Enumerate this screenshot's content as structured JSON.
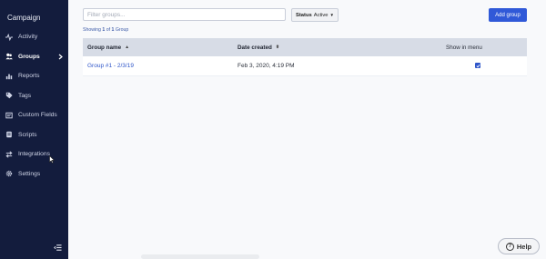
{
  "sidebar": {
    "app_title": "Campaign",
    "items": [
      {
        "label": "Activity",
        "icon": "activity-icon"
      },
      {
        "label": "Groups",
        "icon": "users-icon",
        "active": true
      },
      {
        "label": "Reports",
        "icon": "bar-chart-icon"
      },
      {
        "label": "Tags",
        "icon": "tag-icon"
      },
      {
        "label": "Custom Fields",
        "icon": "custom-fields-icon"
      },
      {
        "label": "Scripts",
        "icon": "scripts-icon"
      },
      {
        "label": "Integrations",
        "icon": "integrations-icon"
      },
      {
        "label": "Settings",
        "icon": "gear-icon"
      }
    ]
  },
  "toolbar": {
    "filter_placeholder": "Filter groups...",
    "status_label": "Status",
    "status_value": "Active",
    "add_button": "Add group"
  },
  "count": {
    "prefix": "Showing",
    "from": "1",
    "of": "of",
    "total": "1",
    "suffix": "Group"
  },
  "table": {
    "columns": [
      "Group name",
      "Date created",
      "Show in menu"
    ],
    "rows": [
      {
        "name": "Group #1 - 2/3/19",
        "date": "Feb 3, 2020, 4:19 PM",
        "show_in_menu": true
      }
    ]
  },
  "help": {
    "label": "Help"
  },
  "colors": {
    "sidebar_bg": "#131c3d",
    "accent": "#3059d8",
    "link": "#2f56c9",
    "header_bg": "#d7dce6"
  }
}
